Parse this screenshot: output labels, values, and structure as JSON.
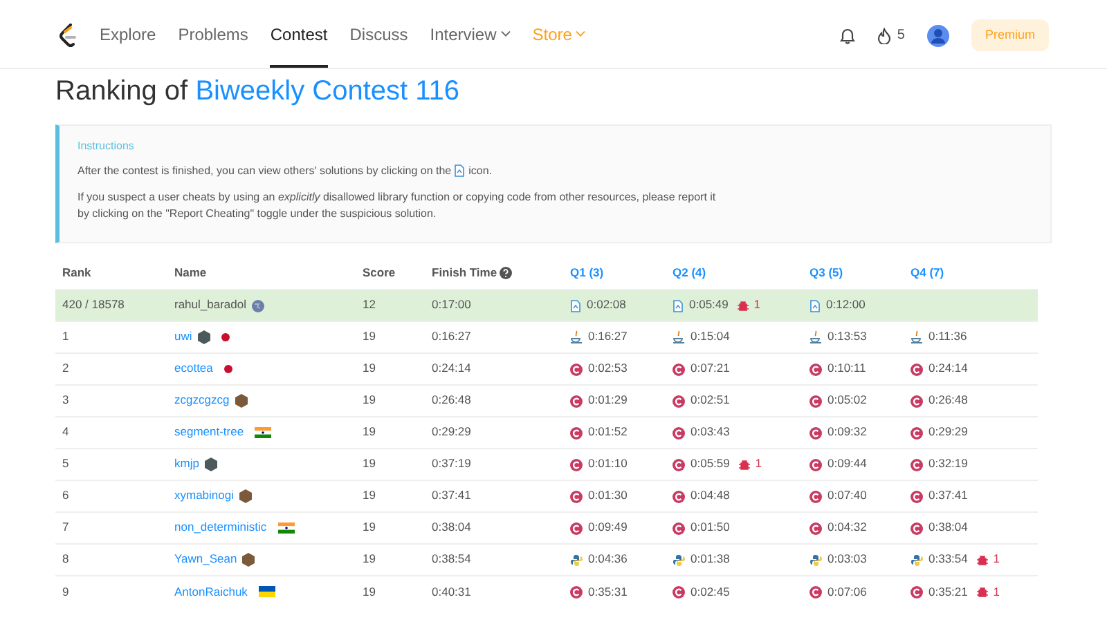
{
  "nav": {
    "items": [
      {
        "label": "Explore",
        "selected": false,
        "dropdown": false,
        "kind": "plain"
      },
      {
        "label": "Problems",
        "selected": false,
        "dropdown": false,
        "kind": "plain"
      },
      {
        "label": "Contest",
        "selected": true,
        "dropdown": false,
        "kind": "plain"
      },
      {
        "label": "Discuss",
        "selected": false,
        "dropdown": false,
        "kind": "plain"
      },
      {
        "label": "Interview",
        "selected": false,
        "dropdown": true,
        "kind": "plain"
      },
      {
        "label": "Store",
        "selected": false,
        "dropdown": true,
        "kind": "store"
      }
    ],
    "streak": "5",
    "premium": "Premium"
  },
  "title": {
    "prefix": "Ranking of",
    "contest": "Biweekly Contest 116"
  },
  "instructions": {
    "heading": "Instructions",
    "line1_before": "After the contest is finished, you can view others' solutions by clicking on the",
    "line1_after": "icon.",
    "line2": "If you suspect a user cheats by using an *explicitly* disallowed library function or copying code from other resources, please report it by clicking on the \"Report Cheating\" toggle under the suspicious solution."
  },
  "table": {
    "columns": [
      {
        "label": "Rank",
        "kind": "plain"
      },
      {
        "label": "Name",
        "kind": "plain"
      },
      {
        "label": "Score",
        "kind": "plain"
      },
      {
        "label": "Finish Time",
        "kind": "help"
      },
      {
        "label": "Q1 (3)",
        "kind": "question"
      },
      {
        "label": "Q2 (4)",
        "kind": "question"
      },
      {
        "label": "Q3 (5)",
        "kind": "question"
      },
      {
        "label": "Q4 (7)",
        "kind": "question"
      }
    ],
    "rows": [
      {
        "highlighted": true,
        "rank": "420 / 18578",
        "name": "rahul_baradol",
        "badges": [
          {
            "kind": "globe",
            "color": "#6c7fa8"
          }
        ],
        "score": "12",
        "finish": "0:17:00",
        "cells": [
          {
            "kind": "doc",
            "time": "0:02:08"
          },
          {
            "kind": "doc",
            "time": "0:05:49",
            "bugs": "1"
          },
          {
            "kind": "doc",
            "time": "0:12:00"
          },
          null
        ]
      },
      {
        "highlighted": false,
        "rank": "1",
        "name": "uwi",
        "badges": [
          {
            "kind": "hex",
            "color": "#4d5a5c"
          },
          {
            "kind": "flag-jp",
            "color": "#c8102e"
          }
        ],
        "score": "19",
        "finish": "0:16:27",
        "cells": [
          {
            "kind": "java",
            "time": "0:16:27"
          },
          {
            "kind": "java",
            "time": "0:15:04"
          },
          {
            "kind": "java",
            "time": "0:13:53"
          },
          {
            "kind": "java",
            "time": "0:11:36"
          }
        ]
      },
      {
        "highlighted": false,
        "rank": "2",
        "name": "ecottea",
        "badges": [
          {
            "kind": "flag-jp",
            "color": "#c8102e"
          }
        ],
        "score": "19",
        "finish": "0:24:14",
        "cells": [
          {
            "kind": "cpp",
            "time": "0:02:53"
          },
          {
            "kind": "cpp",
            "time": "0:07:21"
          },
          {
            "kind": "cpp",
            "time": "0:10:11"
          },
          {
            "kind": "cpp",
            "time": "0:24:14"
          }
        ]
      },
      {
        "highlighted": false,
        "rank": "3",
        "name": "zcgzcgzcg",
        "badges": [
          {
            "kind": "hex",
            "color": "#7a5a3a"
          }
        ],
        "score": "19",
        "finish": "0:26:48",
        "cells": [
          {
            "kind": "cpp",
            "time": "0:01:29"
          },
          {
            "kind": "cpp",
            "time": "0:02:51"
          },
          {
            "kind": "cpp",
            "time": "0:05:02"
          },
          {
            "kind": "cpp",
            "time": "0:26:48"
          }
        ]
      },
      {
        "highlighted": false,
        "rank": "4",
        "name": "segment-tree",
        "badges": [
          {
            "kind": "flag-in",
            "color": "#ff9933"
          }
        ],
        "score": "19",
        "finish": "0:29:29",
        "cells": [
          {
            "kind": "cpp",
            "time": "0:01:52"
          },
          {
            "kind": "cpp",
            "time": "0:03:43"
          },
          {
            "kind": "cpp",
            "time": "0:09:32"
          },
          {
            "kind": "cpp",
            "time": "0:29:29"
          }
        ]
      },
      {
        "highlighted": false,
        "rank": "5",
        "name": "kmjp",
        "badges": [
          {
            "kind": "hex",
            "color": "#4d5a5c"
          }
        ],
        "score": "19",
        "finish": "0:37:19",
        "cells": [
          {
            "kind": "cpp",
            "time": "0:01:10"
          },
          {
            "kind": "cpp",
            "time": "0:05:59",
            "bugs": "1"
          },
          {
            "kind": "cpp",
            "time": "0:09:44"
          },
          {
            "kind": "cpp",
            "time": "0:32:19"
          }
        ]
      },
      {
        "highlighted": false,
        "rank": "6",
        "name": "xymabinogi",
        "badges": [
          {
            "kind": "hex",
            "color": "#7a5a3a"
          }
        ],
        "score": "19",
        "finish": "0:37:41",
        "cells": [
          {
            "kind": "cpp",
            "time": "0:01:30"
          },
          {
            "kind": "cpp",
            "time": "0:04:48"
          },
          {
            "kind": "cpp",
            "time": "0:07:40"
          },
          {
            "kind": "cpp",
            "time": "0:37:41"
          }
        ]
      },
      {
        "highlighted": false,
        "rank": "7",
        "name": "non_deterministic",
        "badges": [
          {
            "kind": "flag-in",
            "color": "#ff9933"
          }
        ],
        "score": "19",
        "finish": "0:38:04",
        "cells": [
          {
            "kind": "cpp",
            "time": "0:09:49"
          },
          {
            "kind": "cpp",
            "time": "0:01:50"
          },
          {
            "kind": "cpp",
            "time": "0:04:32"
          },
          {
            "kind": "cpp",
            "time": "0:38:04"
          }
        ]
      },
      {
        "highlighted": false,
        "rank": "8",
        "name": "Yawn_Sean",
        "badges": [
          {
            "kind": "hex",
            "color": "#7a5a3a"
          }
        ],
        "score": "19",
        "finish": "0:38:54",
        "cells": [
          {
            "kind": "python",
            "time": "0:04:36"
          },
          {
            "kind": "python",
            "time": "0:01:38"
          },
          {
            "kind": "python",
            "time": "0:03:03"
          },
          {
            "kind": "python",
            "time": "0:33:54",
            "bugs": "1"
          }
        ]
      },
      {
        "highlighted": false,
        "rank": "9",
        "name": "AntonRaichuk",
        "badges": [
          {
            "kind": "flag-ua",
            "color": "#0057b7"
          }
        ],
        "score": "19",
        "finish": "0:40:31",
        "cells": [
          {
            "kind": "cpp",
            "time": "0:35:31"
          },
          {
            "kind": "cpp",
            "time": "0:02:45"
          },
          {
            "kind": "cpp",
            "time": "0:07:06"
          },
          {
            "kind": "cpp",
            "time": "0:35:21",
            "bugs": "1"
          }
        ]
      }
    ]
  }
}
